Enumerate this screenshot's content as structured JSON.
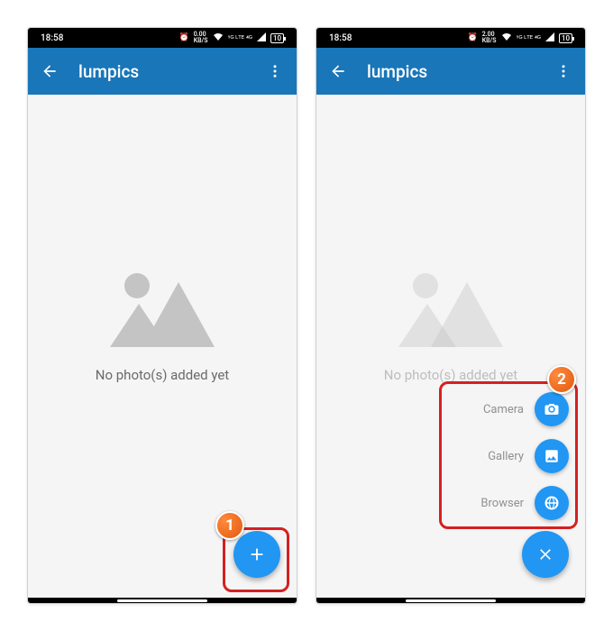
{
  "colors": {
    "app_bar": "#1976b8",
    "fab": "#2196f3",
    "callout_border": "#d62020",
    "badge_gradient_from": "#ff8a3c",
    "badge_gradient_to": "#e05a10"
  },
  "screens": [
    {
      "status": {
        "time": "18:58",
        "net_speed": "0.00",
        "net_unit": "KB/S",
        "battery": "10"
      },
      "app_bar": {
        "title": "lumpics"
      },
      "empty_state": {
        "text": "No photo(s) added yet"
      },
      "fab": {
        "icon": "plus"
      },
      "callout_number": "1"
    },
    {
      "status": {
        "time": "18:58",
        "net_speed": "2.00",
        "net_unit": "KB/S",
        "battery": "10"
      },
      "app_bar": {
        "title": "lumpics"
      },
      "empty_state": {
        "text": "No photo(s) added yet"
      },
      "fab": {
        "icon": "close"
      },
      "speed_dial": [
        {
          "label": "Camera",
          "icon": "camera"
        },
        {
          "label": "Gallery",
          "icon": "gallery"
        },
        {
          "label": "Browser",
          "icon": "browser"
        }
      ],
      "callout_number": "2"
    }
  ]
}
